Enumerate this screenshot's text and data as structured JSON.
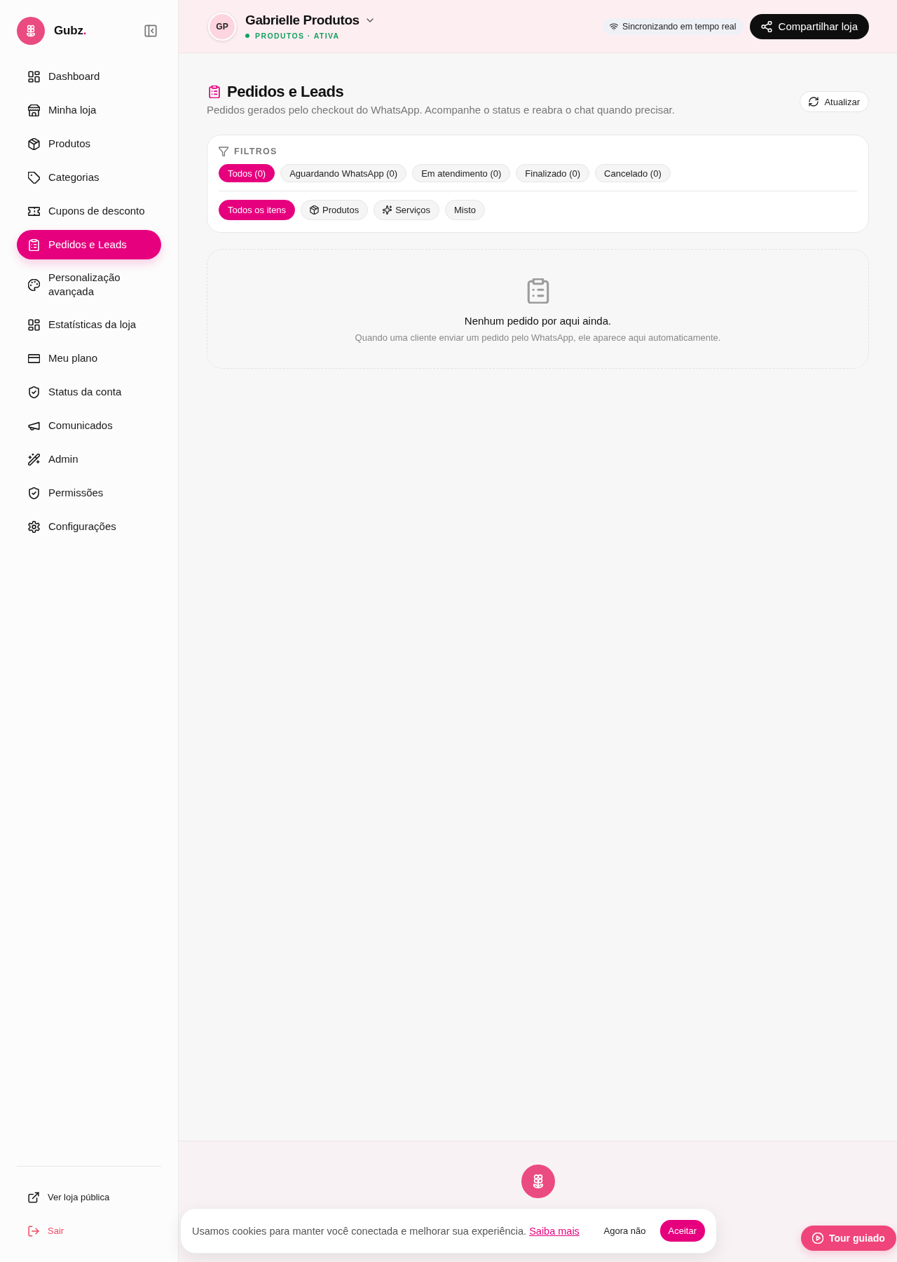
{
  "sidebar": {
    "brand": {
      "name": "Gubz",
      "mark": "."
    },
    "nav": [
      {
        "label": "Dashboard",
        "selected": false
      },
      {
        "label": "Minha loja",
        "selected": false
      },
      {
        "label": "Produtos",
        "selected": false
      },
      {
        "label": "Categorias",
        "selected": false
      },
      {
        "label": "Cupons de desconto",
        "selected": false
      },
      {
        "label": "Pedidos e Leads",
        "selected": true
      },
      {
        "label": "Personalização avançada",
        "selected": false
      },
      {
        "label": "Estatísticas da loja",
        "selected": false
      },
      {
        "label": "Meu plano",
        "selected": false
      },
      {
        "label": "Status da conta",
        "selected": false
      },
      {
        "label": "Comunicados",
        "selected": false
      },
      {
        "label": "Admin",
        "selected": false
      },
      {
        "label": "Permissões",
        "selected": false
      },
      {
        "label": "Configurações",
        "selected": false
      }
    ],
    "footer_links": [
      {
        "label": "Ver loja pública",
        "kind": "link"
      },
      {
        "label": "Sair",
        "kind": "logout"
      }
    ]
  },
  "header": {
    "initials": "GP",
    "store_name": "Gabrielle Produtos",
    "status": "PRODUTOS · ATIVA",
    "sync": "Sincronizando em tempo real",
    "share_button": "Compartilhar loja"
  },
  "page": {
    "title": "Pedidos e Leads",
    "subtitle": "Pedidos gerados pelo checkout do WhatsApp. Acompanhe o status e reabra o chat quando precisar.",
    "refresh_button": "Atualizar"
  },
  "filters": {
    "label": "FILTROS",
    "status_chips": [
      {
        "label": "Todos (0)",
        "selected": true
      },
      {
        "label": "Aguardando WhatsApp (0)",
        "selected": false
      },
      {
        "label": "Em atendimento (0)",
        "selected": false
      },
      {
        "label": "Finalizado (0)",
        "selected": false
      },
      {
        "label": "Cancelado (0)",
        "selected": false
      }
    ],
    "type_chips": [
      {
        "label": "Todos os itens",
        "selected": true
      },
      {
        "label": "Produtos",
        "selected": false
      },
      {
        "label": "Serviços",
        "selected": false
      },
      {
        "label": "Misto",
        "selected": false
      }
    ]
  },
  "empty_state": {
    "title": "Nenhum pedido por aqui ainda.",
    "message": "Quando uma cliente enviar um pedido pelo WhatsApp, ele aparece aqui automaticamente."
  },
  "cookie_banner": {
    "message": "Usamos cookies para manter você conectada e melhorar sua experiência.",
    "link": "Saiba mais",
    "decline_button": "Agora não",
    "accept_button": "Aceitar"
  },
  "tour_button": "Tour guiado"
}
